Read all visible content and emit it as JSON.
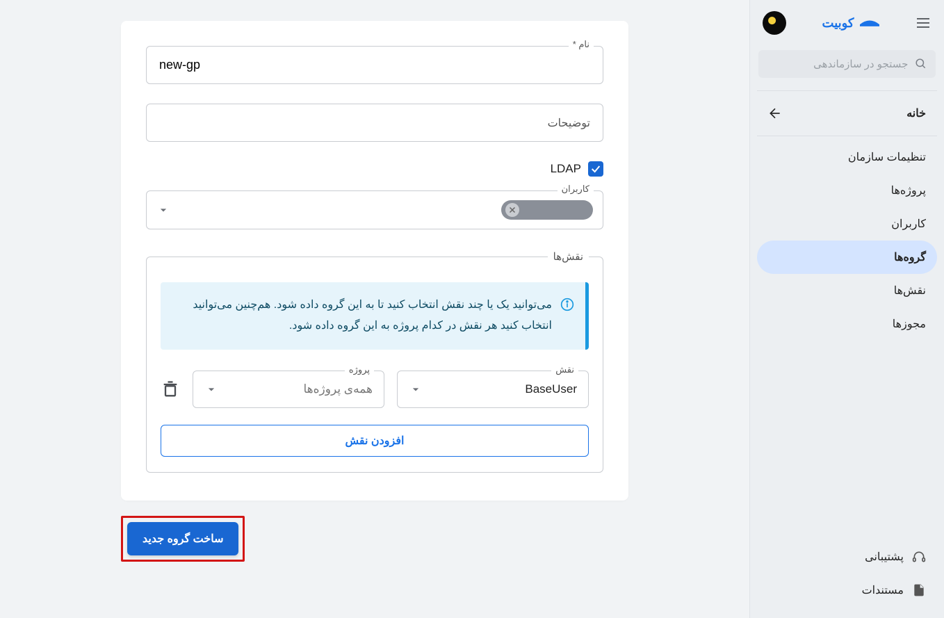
{
  "brand": {
    "name": "کوبیت"
  },
  "search": {
    "placeholder": "جستجو در سازماندهی"
  },
  "nav": {
    "home": "خانه",
    "items": [
      {
        "label": "تنظیمات سازمان"
      },
      {
        "label": "پروژه‌ها"
      },
      {
        "label": "کاربران"
      },
      {
        "label": "گروه‌ها"
      },
      {
        "label": "نقش‌ها"
      },
      {
        "label": "مجوزها"
      }
    ]
  },
  "bottom": {
    "support": "پشتیبانی",
    "docs": "مستندات"
  },
  "form": {
    "name_label": "نام *",
    "name_value": "new-gp",
    "desc_placeholder": "توضیحات",
    "ldap_label": "LDAP",
    "users_label": "کاربران",
    "roles_legend": "نقش‌ها",
    "roles_info": "می‌توانید یک یا چند نقش انتخاب کنید تا به این گروه داده شود. هم‌چنین می‌توانید انتخاب کنید هر نقش در کدام پروژه به این گروه داده شود.",
    "role_label": "نقش",
    "role_value": "BaseUser",
    "project_label": "پروژه",
    "project_placeholder": "همه‌ی پروژه‌ها",
    "add_role": "افزودن نقش",
    "submit": "ساخت گروه جدید"
  }
}
